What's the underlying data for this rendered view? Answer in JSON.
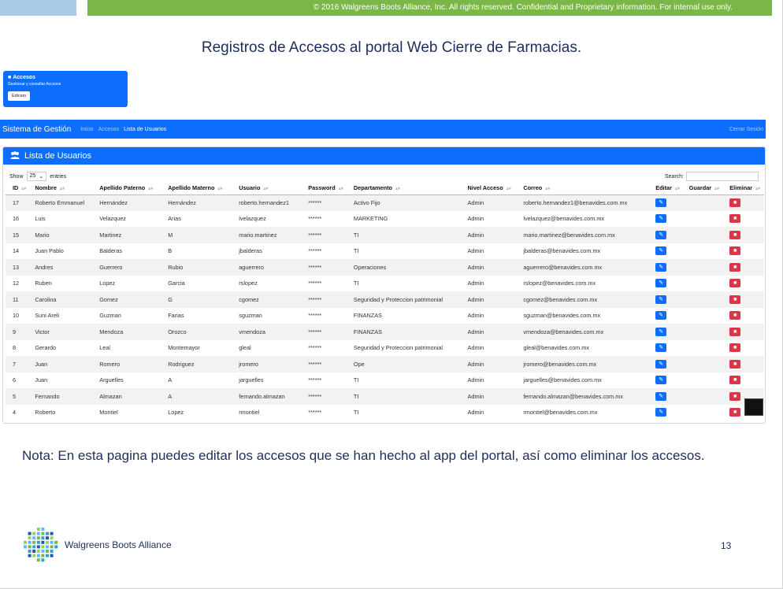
{
  "header": {
    "copyright": "© 2016 Walgreens Boots Alliance, Inc. All rights reserved. Confidential and Proprietary information. For internal use only.",
    "title": "Registros de Accesos al portal Web Cierre de Farmacias."
  },
  "card": {
    "title": "Accesos",
    "subtitle": "Gestionar y consultar Accesos",
    "button": "Edicion"
  },
  "navbar": {
    "brand": "Sistema de Gestión",
    "links": [
      "Inicio",
      "Accesos",
      "Lista de Usuarios"
    ],
    "logout": "Cerrar Sesión"
  },
  "panel": {
    "title": "Lista de Usuarios",
    "show": "Show",
    "entries_value": "25",
    "entries": "entries",
    "search": "Search:"
  },
  "columns": [
    "ID",
    "Nombre",
    "Apellido Paterno",
    "Apellido Materno",
    "Usuario",
    "Password",
    "Departamento",
    "Nivel Acceso",
    "Correo",
    "Editar",
    "Guardar",
    "Eliminar"
  ],
  "rows": [
    [
      "17",
      "Roberto Emmanuel",
      "Hernández",
      "Hernández",
      "roberto.hernandez1",
      "******",
      "Activo Fijo",
      "Admin",
      "roberto.hernandez1@benavides.com.mx"
    ],
    [
      "16",
      "Luis",
      "Velazquez",
      "Arias",
      "lvelazquez",
      "******",
      "MARKETING",
      "Admin",
      "lvelazquez@benavides.com.mx"
    ],
    [
      "15",
      "Mario",
      "Martinez",
      "M",
      "mario.martinez",
      "******",
      "TI",
      "Admin",
      "mario.martinez@benavides.com.mx"
    ],
    [
      "14",
      "Juan Pablo",
      "Balderas",
      "B",
      "jbalderas",
      "******",
      "TI",
      "Admin",
      "jbalderas@benavides.com.mx"
    ],
    [
      "13",
      "Andres",
      "Guerrero",
      "Rubio",
      "aguerrero",
      "******",
      "Operaciones",
      "Admin",
      "aguerrero@benavides.com.mx"
    ],
    [
      "12",
      "Ruben",
      "Lopez",
      "Garcia",
      "rslopez",
      "******",
      "TI",
      "Admin",
      "rslopez@benavides.com.mx"
    ],
    [
      "11",
      "Carolina",
      "Gomez",
      "G",
      "cgomez",
      "******",
      "Seguridad y Proteccion patrimonial",
      "Admin",
      "cgomez@benavides.com.mx"
    ],
    [
      "10",
      "Suni Areli",
      "Guzman",
      "Farias",
      "sguzman",
      "******",
      "FINANZAS",
      "Admin",
      "sguzman@benavides.com.mx"
    ],
    [
      "9",
      "Victor",
      "Mendoza",
      "Orozco",
      "vmendoza",
      "******",
      "FINANZAS",
      "Admin",
      "vmendoza@benavides.com.mx"
    ],
    [
      "8",
      "Gerardo",
      "Leal",
      "Montemayor",
      "gleal",
      "******",
      "Seguridad y Proteccion patrimonial",
      "Admin",
      "gleal@benavides.com.mx"
    ],
    [
      "7",
      "Juan",
      "Romero",
      "Rodriguez",
      "jromero",
      "******",
      "Ope",
      "Admin",
      "jromero@benavides.com.mx"
    ],
    [
      "6",
      "Juan",
      "Arguelles",
      "A",
      "jarguelles",
      "******",
      "TI",
      "Admin",
      "jarguelles@benavides.com.mx"
    ],
    [
      "5",
      "Fernando",
      "Almazan",
      "A",
      "fernando.almazan",
      "******",
      "TI",
      "Admin",
      "fernando.almazan@benavides.com.mx"
    ],
    [
      "4",
      "Roberto",
      "Montiel",
      "Lopez",
      "rmontiel",
      "******",
      "TI",
      "Admin",
      "rmontiel@benavides.com.mx"
    ]
  ],
  "nota": "Nota: En esta pagina puedes editar los accesos  que se han hecho al app del portal, así como eliminar los accesos.",
  "footer": {
    "logo_text": "Walgreens Boots Alliance",
    "page": "13"
  },
  "colors": {
    "primary": "#0d6efd",
    "danger": "#dc3545",
    "green_bar": "#7ab648",
    "title_navy": "#1f2d5c"
  },
  "icons": {
    "users": "users-icon",
    "edit": "edit-icon",
    "delete": "trash-icon",
    "sort": "sort-icon"
  }
}
